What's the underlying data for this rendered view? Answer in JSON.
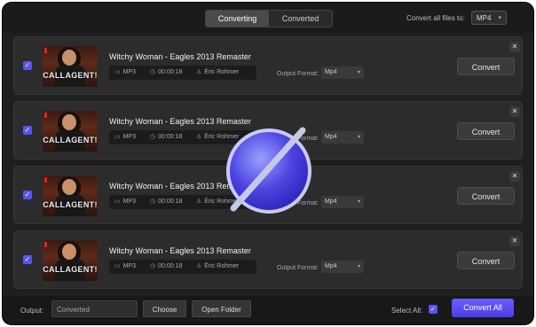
{
  "top": {
    "tabs": [
      "Converting",
      "Converted"
    ],
    "convert_all_label": "Convert all files to:",
    "convert_all_format": "MP4"
  },
  "rows": [
    {
      "title": "Witchy Woman - Eagles 2013 Remaster",
      "thumb_caption": "CALLAGENT!",
      "format": "MP3",
      "duration": "00:00:18",
      "artist": "Éric Rohmer",
      "output_label": "Output Format:",
      "output_format": "Mp4",
      "convert": "Convert"
    },
    {
      "title": "Witchy Woman - Eagles 2013 Remaster",
      "thumb_caption": "CALLAGENT!",
      "format": "MP3",
      "duration": "00:00:18",
      "artist": "Éric Rohmer",
      "output_label": "Output Format:",
      "output_format": "Mp4",
      "convert": "Convert"
    },
    {
      "title": "Witchy Woman - Eagles 2013 Remaster",
      "thumb_caption": "CALLAGENT!",
      "format": "MP3",
      "duration": "00:00:18",
      "artist": "Éric Rohmer",
      "output_label": "Output Format:",
      "output_format": "Mp4",
      "convert": "Convert"
    },
    {
      "title": "Witchy Woman - Eagles 2013 Remaster",
      "thumb_caption": "CALLAGENT!",
      "format": "MP3",
      "duration": "00:00:18",
      "artist": "Éric Rohmer",
      "output_label": "Output Format:",
      "output_format": "Mp4",
      "convert": "Convert"
    }
  ],
  "bottom": {
    "output_label": "Output:",
    "output_value": "Converted",
    "choose": "Choose",
    "open_folder": "Open Folder",
    "select_all": "Select All:",
    "convert_all": "Convert All"
  },
  "icons": {
    "checkbox": "checkmark-icon",
    "video": "video-icon",
    "clock": "clock-icon",
    "person": "person-icon",
    "close": "close-icon",
    "overlay": "no-entry-icon"
  },
  "colors": {
    "accent": "#5b53f5",
    "window_bg": "#1f1f1f",
    "row_bg": "#2c2c2c"
  }
}
